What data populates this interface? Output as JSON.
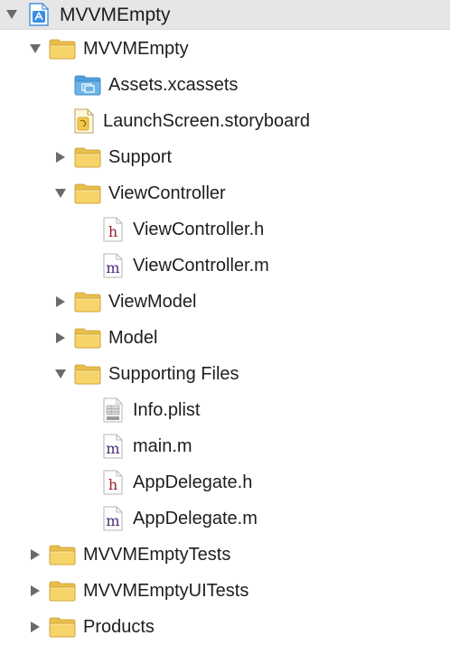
{
  "project": {
    "name": "MVVMEmpty",
    "icon": "xcode-project-icon",
    "expanded": true
  },
  "tree": [
    {
      "label": "MVVMEmpty",
      "kind": "folder",
      "disclosure": "expanded",
      "level": 1
    },
    {
      "label": "Assets.xcassets",
      "kind": "assets",
      "disclosure": "none",
      "level": 2
    },
    {
      "label": "LaunchScreen.storyboard",
      "kind": "storyboard",
      "disclosure": "none",
      "level": 2
    },
    {
      "label": "Support",
      "kind": "folder",
      "disclosure": "collapsed",
      "level": 2
    },
    {
      "label": "ViewController",
      "kind": "folder",
      "disclosure": "expanded",
      "level": 2
    },
    {
      "label": "ViewController.h",
      "kind": "h",
      "disclosure": "none",
      "level": 3
    },
    {
      "label": "ViewController.m",
      "kind": "m",
      "disclosure": "none",
      "level": 3
    },
    {
      "label": "ViewModel",
      "kind": "folder",
      "disclosure": "collapsed",
      "level": 2
    },
    {
      "label": "Model",
      "kind": "folder",
      "disclosure": "collapsed",
      "level": 2
    },
    {
      "label": "Supporting Files",
      "kind": "folder",
      "disclosure": "expanded",
      "level": 2
    },
    {
      "label": "Info.plist",
      "kind": "plist",
      "disclosure": "none",
      "level": 3
    },
    {
      "label": "main.m",
      "kind": "m",
      "disclosure": "none",
      "level": 3
    },
    {
      "label": "AppDelegate.h",
      "kind": "h",
      "disclosure": "none",
      "level": 3
    },
    {
      "label": "AppDelegate.m",
      "kind": "m",
      "disclosure": "none",
      "level": 3
    },
    {
      "label": "MVVMEmptyTests",
      "kind": "folder",
      "disclosure": "collapsed",
      "level": 1
    },
    {
      "label": "MVVMEmptyUITests",
      "kind": "folder",
      "disclosure": "collapsed",
      "level": 1
    },
    {
      "label": "Products",
      "kind": "folder",
      "disclosure": "collapsed",
      "level": 1
    }
  ],
  "icon_names": {
    "folder": "folder-icon",
    "assets": "asset-catalog-icon",
    "storyboard": "storyboard-icon",
    "h": "header-file-icon",
    "m": "objc-source-file-icon",
    "plist": "plist-file-icon"
  },
  "colors": {
    "folder_front": "#f6d46a",
    "folder_back": "#e9bf4b",
    "folder_edge": "#c99b2e",
    "assets_blue": "#6cb4e8",
    "header_red": "#9c1f2a",
    "source_purple": "#4a2a7a",
    "disclosure_gray": "#6a6a6a",
    "root_bg": "#e6e6e6"
  }
}
